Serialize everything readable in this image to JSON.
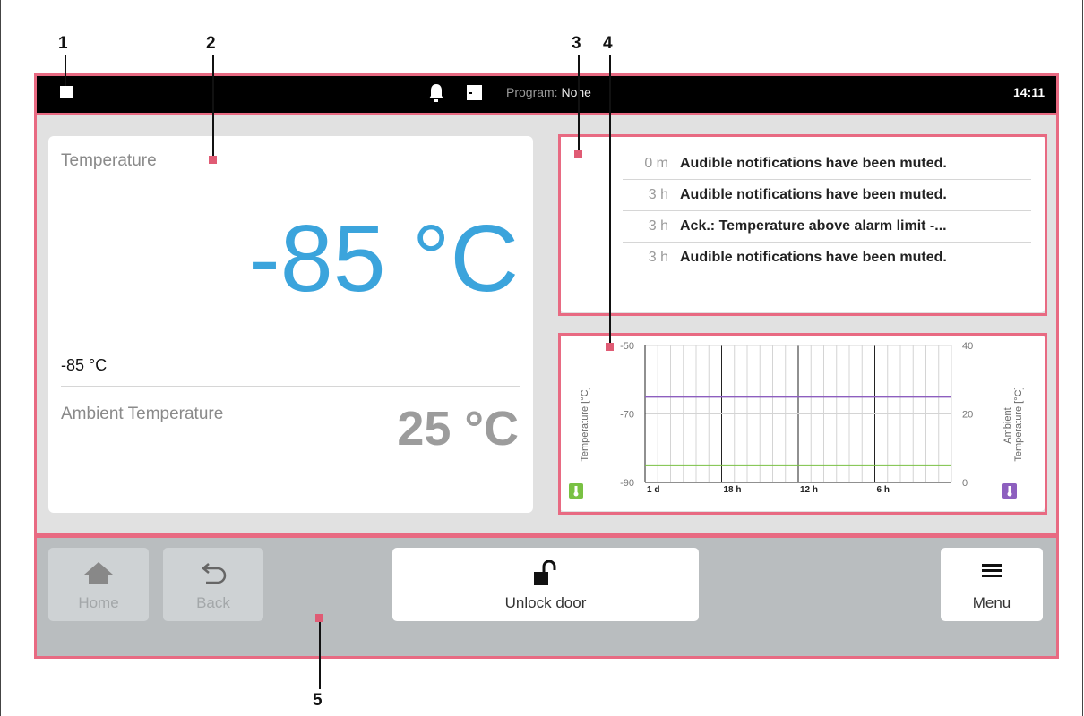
{
  "callouts": [
    "1",
    "2",
    "3",
    "4",
    "5"
  ],
  "status_bar": {
    "icons": [
      "screen-indicator-icon",
      "bell-icon",
      "door-icon"
    ],
    "program_label": "Program:",
    "program_value": "None",
    "time": "14:11"
  },
  "temperature": {
    "title": "Temperature",
    "current": "-85 °C",
    "setpoint": "-85 °C",
    "ambient_label": "Ambient Temperature",
    "ambient_value": "25 °C"
  },
  "notifications": [
    {
      "age": "0 m",
      "text": "Audible notifications have been muted."
    },
    {
      "age": "3 h",
      "text": "Audible notifications have been muted."
    },
    {
      "age": "3 h",
      "text": "Ack.: Temperature above alarm limit -..."
    },
    {
      "age": "3 h",
      "text": "Audible notifications have been muted."
    }
  ],
  "chart_data": {
    "type": "line",
    "ylabel": "Temperature [°C]",
    "ylabel_right": "Ambient Temperature [°C]",
    "ylabel_right_lines": [
      "Ambient",
      "Temperature [°C]"
    ],
    "y_ticks": [
      "-50",
      "-70",
      "-90"
    ],
    "y_right_ticks": [
      "40",
      "20",
      "0"
    ],
    "x_ticks": [
      "1 d",
      "18 h",
      "12 h",
      "6 h"
    ],
    "ylim": [
      -90,
      -50
    ],
    "ylim_right": [
      0,
      40
    ],
    "series": [
      {
        "name": "Temperature",
        "axis": "left",
        "color": "#79c143",
        "x": [
          24,
          20,
          16,
          12,
          8,
          4,
          0
        ],
        "values": [
          -85,
          -85,
          -85,
          -85,
          -85,
          -85,
          -85
        ]
      },
      {
        "name": "Ambient Temperature",
        "axis": "right",
        "color": "#8d5fbf",
        "x": [
          24,
          20,
          16,
          12,
          8,
          4,
          0
        ],
        "values": [
          25,
          25,
          25,
          25,
          25,
          25,
          25
        ]
      }
    ],
    "x_unit": "hours ago",
    "grid": true,
    "legend_icons": [
      "thermometer-icon-green",
      "thermometer-icon-purple"
    ]
  },
  "buttons": {
    "home": "Home",
    "back": "Back",
    "unlock": "Unlock door",
    "menu": "Menu"
  },
  "colors": {
    "highlight": "#e86a82",
    "temperature_value": "#3ba4dc",
    "temperature_series": "#79c143",
    "ambient_series": "#8d5fbf"
  }
}
